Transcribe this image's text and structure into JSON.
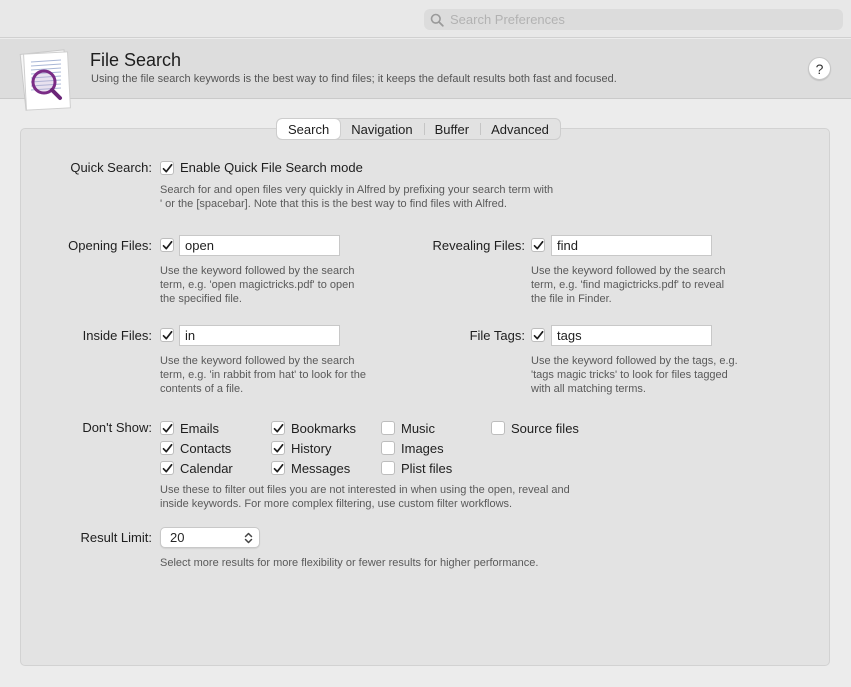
{
  "search": {
    "placeholder": "Search Preferences"
  },
  "header": {
    "title": "File Search",
    "subtitle": "Using the file search keywords is the best way to find files; it keeps the default results both fast and focused.",
    "help_label": "?"
  },
  "tabs": [
    {
      "label": "Search",
      "active": true
    },
    {
      "label": "Navigation",
      "active": false
    },
    {
      "label": "Buffer",
      "active": false
    },
    {
      "label": "Advanced",
      "active": false
    }
  ],
  "quick_search": {
    "label": "Quick Search:",
    "checkbox_label": "Enable Quick File Search mode",
    "checked": true,
    "description_lines": [
      "Search for and open files very quickly in Alfred by prefixing your search term with",
      "' or the [spacebar]. Note that this is the best way to find files with Alfred."
    ]
  },
  "opening_files": {
    "label": "Opening Files:",
    "checked": true,
    "value": "open",
    "description_lines": [
      "Use the keyword followed by the search",
      "term, e.g. 'open magictricks.pdf' to open",
      "the specified file."
    ]
  },
  "revealing_files": {
    "label": "Revealing Files:",
    "checked": true,
    "value": "find",
    "description_lines": [
      "Use the keyword followed by the search",
      "term, e.g. 'find magictricks.pdf' to reveal",
      "the file in Finder."
    ]
  },
  "inside_files": {
    "label": "Inside Files:",
    "checked": true,
    "value": "in",
    "description_lines": [
      "Use the keyword followed by the search",
      "term, e.g. 'in rabbit from hat' to look for the",
      "contents of a file."
    ]
  },
  "file_tags": {
    "label": "File Tags:",
    "checked": true,
    "value": "tags",
    "description_lines": [
      "Use the keyword followed by the tags, e.g.",
      "'tags magic tricks' to look for files tagged",
      "with all matching terms."
    ]
  },
  "dont_show": {
    "label": "Don't Show:",
    "options": [
      {
        "label": "Emails",
        "checked": true
      },
      {
        "label": "Contacts",
        "checked": true
      },
      {
        "label": "Calendar",
        "checked": true
      },
      {
        "label": "Bookmarks",
        "checked": true
      },
      {
        "label": "History",
        "checked": true
      },
      {
        "label": "Messages",
        "checked": true
      },
      {
        "label": "Music",
        "checked": false
      },
      {
        "label": "Images",
        "checked": false
      },
      {
        "label": "Plist files",
        "checked": false
      },
      {
        "label": "Source files",
        "checked": false
      }
    ],
    "description_lines": [
      "Use these to filter out files you are not interested in when using the open, reveal and",
      "inside keywords. For more complex filtering, use custom filter workflows."
    ]
  },
  "result_limit": {
    "label": "Result Limit:",
    "value": "20",
    "description": "Select more results for more flexibility or fewer results for higher performance."
  },
  "icons": {
    "search": "magnifier-icon",
    "header": "document-magnifier-icon",
    "check": "checkmark-icon",
    "select": "up-down-chevron-icon"
  },
  "colors": {
    "accent": "#7a2c86",
    "panel": "#e3e3e3",
    "header": "#dddddd"
  }
}
